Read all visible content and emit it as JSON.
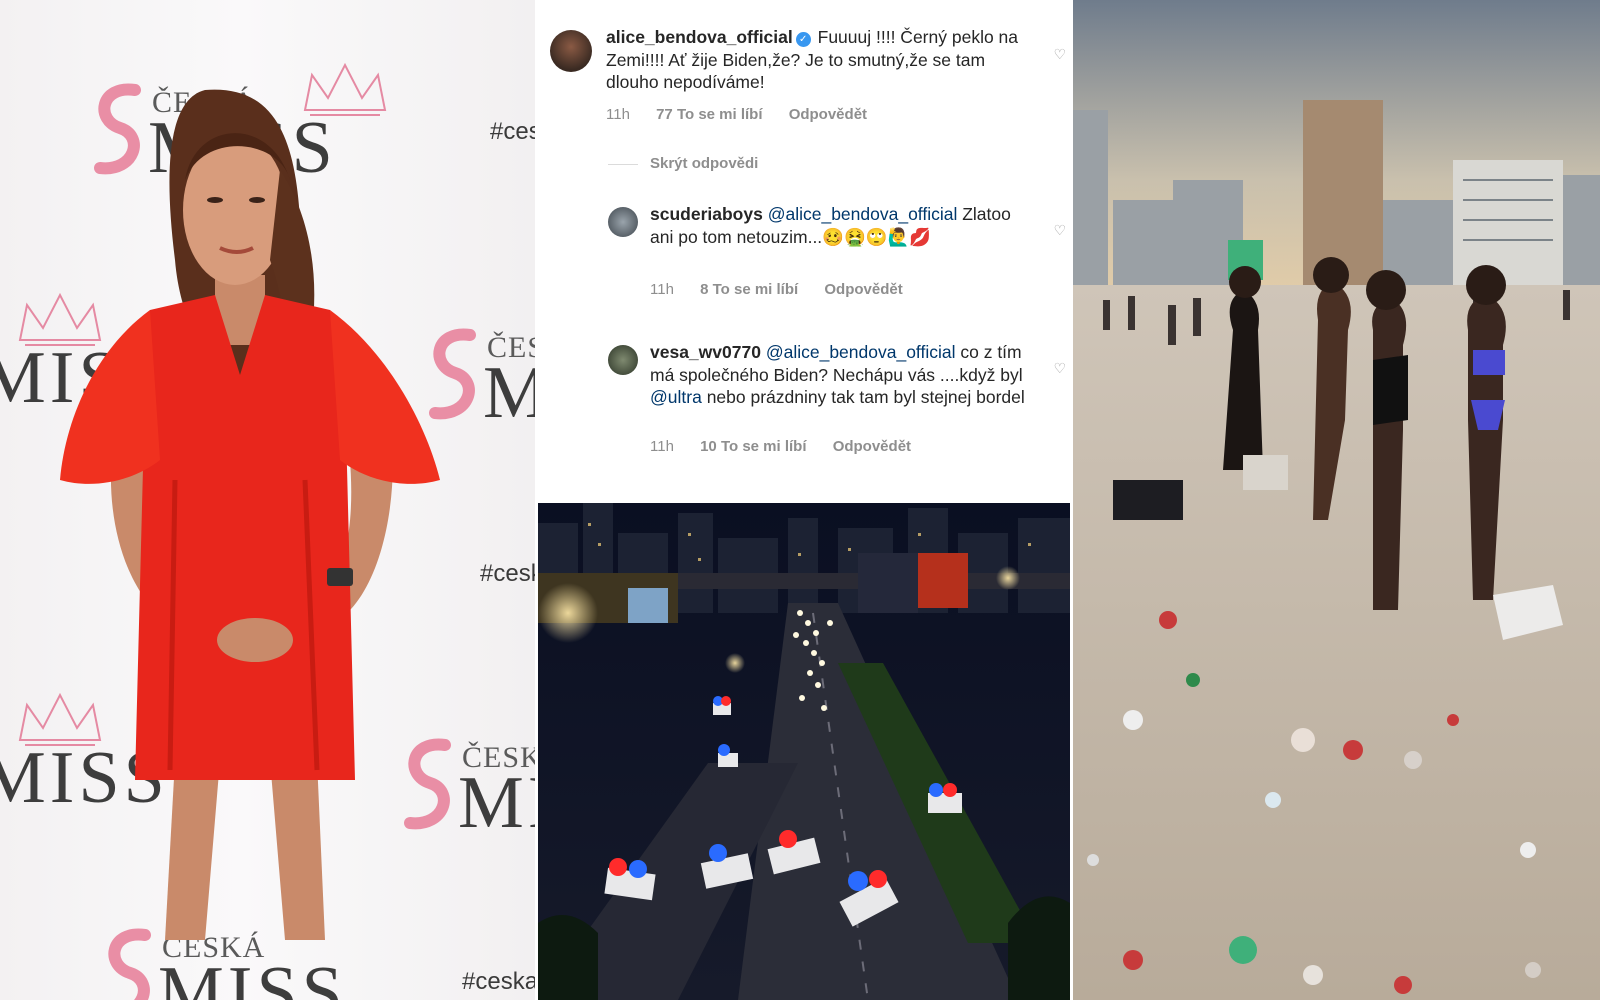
{
  "left_photo": {
    "logo_small": "ČESKÁ",
    "logo_big": "MISS",
    "hashtag": "#ceska"
  },
  "comments": [
    {
      "username": "alice_bendova_official",
      "verified": true,
      "text": "Fuuuuj !!!! Černý peklo na Zemi!!!! Ať žije Biden,že? Je to smutný,že se tam dlouho nepodíváme!",
      "time": "11h",
      "likes": "77 To se mi líbí",
      "reply": "Odpovědět"
    },
    {
      "username": "scuderiaboys",
      "mention": "@alice_bendova_official",
      "text": "Zlatoo ani po tom netouzim...🥴🤮🙄🙋‍♂️💋",
      "time": "11h",
      "likes": "8 To se mi líbí",
      "reply": "Odpovědět"
    },
    {
      "username": "vesa_wv0770",
      "mention": "@alice_bendova_official",
      "text_before": "co z tím má společného Biden? Nechápu vás ....když byl",
      "mention2": "@ultra",
      "text_after": "nebo prázdniny tak tam byl stejnej bordel",
      "time": "11h",
      "likes": "10 To se mi líbí",
      "reply": "Odpovědět"
    }
  ],
  "hide_replies": "Skrýt odpovědi",
  "colors": {
    "dress": "#e8261c",
    "link": "#00376b",
    "meta_gray": "#8e8e8e",
    "verified_blue": "#3897f0",
    "police_blue": "#2a6bff",
    "police_red": "#ff2b2b"
  }
}
